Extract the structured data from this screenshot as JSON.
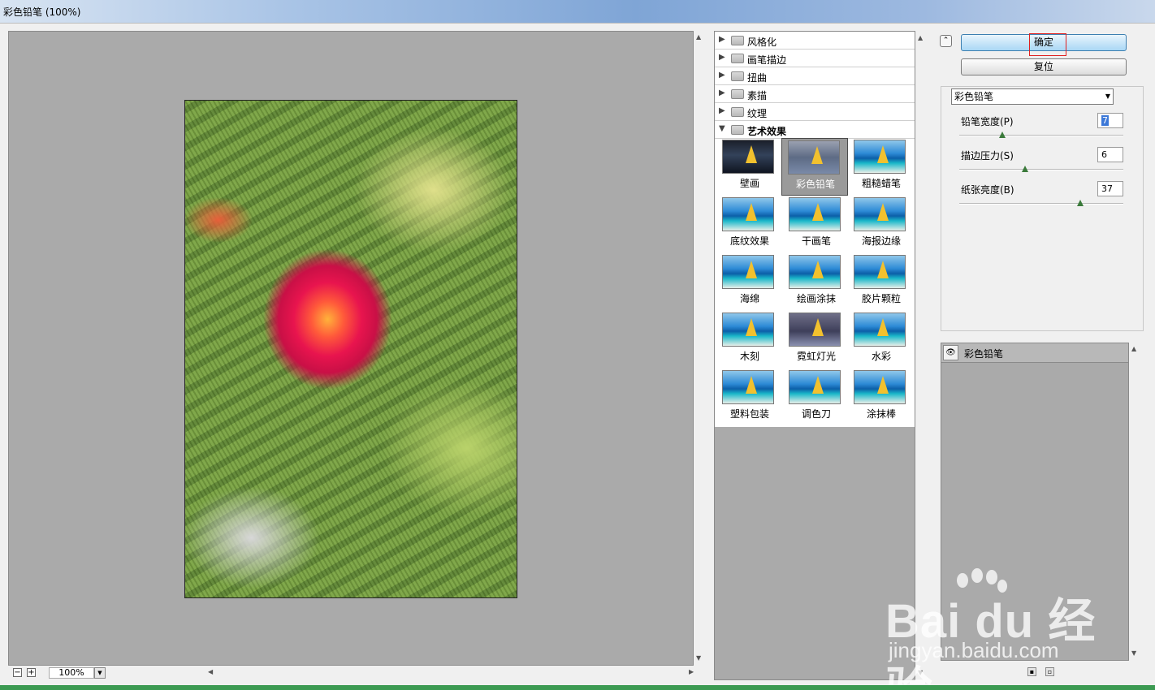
{
  "window": {
    "title": "彩色铅笔 (100%)"
  },
  "preview": {
    "zoom": "100%",
    "zoom_out": "−",
    "zoom_in": "+"
  },
  "gallery": {
    "categories": [
      {
        "label": "风格化",
        "open": false
      },
      {
        "label": "画笔描边",
        "open": false
      },
      {
        "label": "扭曲",
        "open": false
      },
      {
        "label": "素描",
        "open": false
      },
      {
        "label": "纹理",
        "open": false
      },
      {
        "label": "艺术效果",
        "open": true
      }
    ],
    "filters": [
      "壁画",
      "彩色铅笔",
      "粗糙蜡笔",
      "底纹效果",
      "干画笔",
      "海报边缘",
      "海绵",
      "绘画涂抹",
      "胶片颗粒",
      "木刻",
      "霓虹灯光",
      "水彩",
      "塑料包装",
      "调色刀",
      "涂抹棒"
    ],
    "selected": "彩色铅笔"
  },
  "buttons": {
    "ok": "确定",
    "reset": "复位"
  },
  "settings": {
    "filter_select": "彩色铅笔",
    "params": [
      {
        "label": "铅笔宽度(P)",
        "value": "7",
        "slider_fraction": 0.26
      },
      {
        "label": "描边压力(S)",
        "value": "6",
        "slider_fraction": 0.4
      },
      {
        "label": "纸张亮度(B)",
        "value": "37",
        "slider_fraction": 0.74
      }
    ]
  },
  "layers": {
    "items": [
      "彩色铅笔"
    ]
  },
  "watermark": {
    "logo": "Bai  du 经验",
    "url": "jingyan.baidu.com"
  }
}
